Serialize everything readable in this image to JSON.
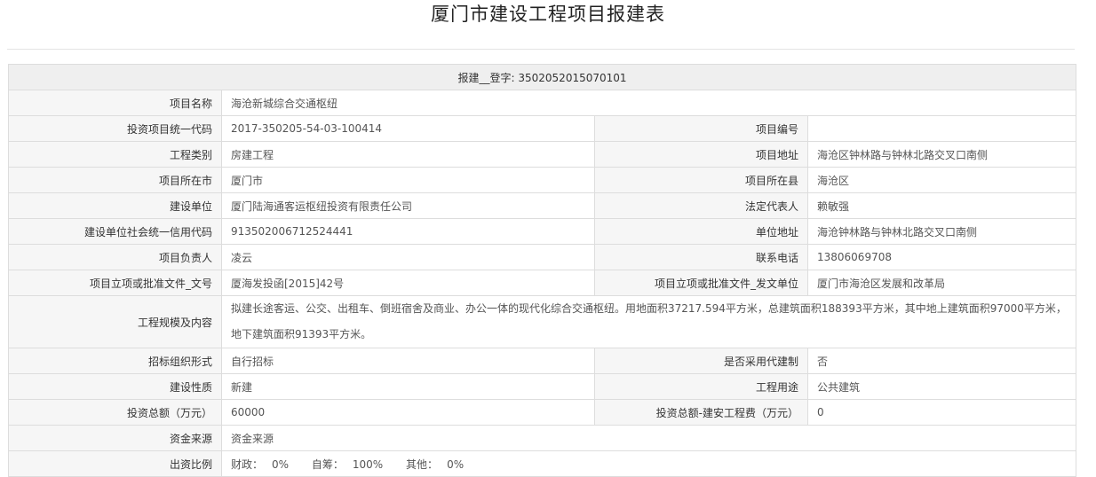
{
  "page": {
    "title": "厦门市建设工程项目报建表"
  },
  "header": {
    "registration_label": "报建__登字:",
    "registration_number": "3502052015070101"
  },
  "form": {
    "project_name": {
      "label": "项目名称",
      "value": "海沧新城综合交通枢纽"
    },
    "investment_code": {
      "label": "投资项目统一代码",
      "value": "2017-350205-54-03-100414"
    },
    "project_number": {
      "label": "项目编号",
      "value": ""
    },
    "project_category": {
      "label": "工程类别",
      "value": "房建工程"
    },
    "project_address": {
      "label": "项目地址",
      "value": "海沧区钟林路与钟林北路交叉口南侧"
    },
    "project_city": {
      "label": "项目所在市",
      "value": "厦门市"
    },
    "project_county": {
      "label": "项目所在县",
      "value": "海沧区"
    },
    "builder_unit": {
      "label": "建设单位",
      "value": "厦门陆海通客运枢纽投资有限责任公司"
    },
    "legal_rep": {
      "label": "法定代表人",
      "value": "赖敏强"
    },
    "credit_code": {
      "label": "建设单位社会统一信用代码",
      "value": "913502006712524441"
    },
    "unit_address": {
      "label": "单位地址",
      "value": "海沧钟林路与钟林北路交叉口南侧"
    },
    "project_lead": {
      "label": "项目负责人",
      "value": "凌云"
    },
    "contact_phone": {
      "label": "联系电话",
      "value": "13806069708"
    },
    "approval_doc_no": {
      "label": "项目立项或批准文件_文号",
      "value": "厦海发投函[2015]42号"
    },
    "approval_issuer": {
      "label": "项目立项或批准文件_发文单位",
      "value": "厦门市海沧区发展和改革局"
    },
    "scale_content": {
      "label": "工程规模及内容",
      "value": "拟建长途客运、公交、出租车、倒班宿舍及商业、办公一体的现代化综合交通枢纽。用地面积37217.594平方米，总建筑面积188393平方米，其中地上建筑面积97000平方米，地下建筑面积91393平方米。"
    },
    "tender_form": {
      "label": "招标组织形式",
      "value": "自行招标"
    },
    "agent_build": {
      "label": "是否采用代建制",
      "value": "否"
    },
    "build_nature": {
      "label": "建设性质",
      "value": "新建"
    },
    "project_use": {
      "label": "工程用途",
      "value": "公共建筑"
    },
    "total_investment": {
      "label": "投资总额（万元）",
      "value": "60000"
    },
    "install_cost": {
      "label": "投资总额-建安工程费（万元）",
      "value": "0"
    },
    "fund_source": {
      "label": "资金来源",
      "value": "资金来源"
    },
    "fund_ratio": {
      "label": "出资比例",
      "fiscal_label": "财政：",
      "fiscal_value": "0%",
      "self_label": "自筹：",
      "self_value": "100%",
      "other_label": "其他：",
      "other_value": "0%"
    }
  }
}
